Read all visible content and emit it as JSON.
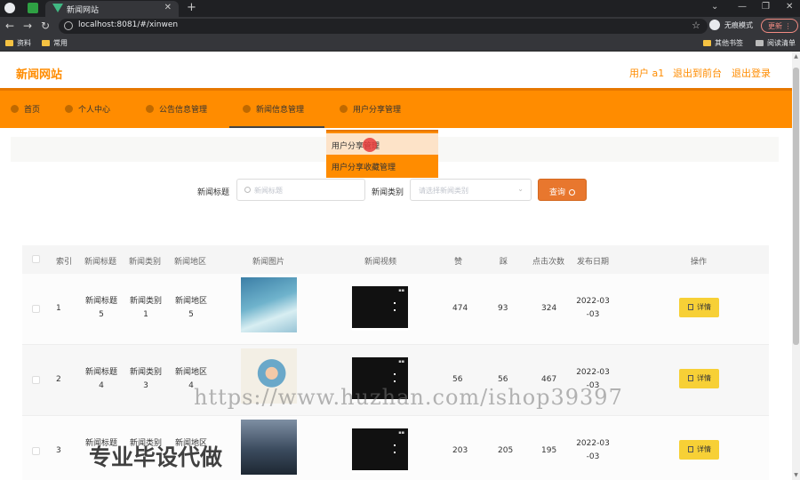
{
  "browser": {
    "tab_title": "新闻网站",
    "url": "localhost:8081/#/xinwen",
    "incognito_label": "无痕模式",
    "update_label": "更新",
    "bookmarks": [
      "资料",
      "常用"
    ],
    "bookmarks_right": [
      "其他书签",
      "阅读清单"
    ]
  },
  "header": {
    "site_title": "新闻网站",
    "user_label": "用户 a1",
    "back_label": "退出到前台",
    "logout_label": "退出登录"
  },
  "nav": {
    "items": [
      "首页",
      "个人中心",
      "公告信息管理",
      "新闻信息管理",
      "用户分享管理"
    ],
    "active_index": 3
  },
  "dropdown": {
    "items": [
      "用户分享管理",
      "用户分享收藏管理"
    ]
  },
  "search": {
    "title_label": "新闻标题",
    "title_placeholder": "新闻标题",
    "category_label": "新闻类别",
    "category_placeholder": "请选择新闻类别",
    "query_label": "查询"
  },
  "table": {
    "headers": [
      "索引",
      "新闻标题",
      "新闻类别",
      "新闻地区",
      "新闻图片",
      "新闻视频",
      "赞",
      "踩",
      "点击次数",
      "发布日期",
      "操作"
    ],
    "rows": [
      {
        "index": "1",
        "title": [
          "新闻标题",
          "5"
        ],
        "category": [
          "新闻类别",
          "1"
        ],
        "region": [
          "新闻地区",
          "5"
        ],
        "likes": "474",
        "dislikes": "93",
        "clicks": "324",
        "date": [
          "2022-03",
          "-03"
        ],
        "action": "详情"
      },
      {
        "index": "2",
        "title": [
          "新闻标题",
          "4"
        ],
        "category": [
          "新闻类别",
          "3"
        ],
        "region": [
          "新闻地区",
          "4"
        ],
        "likes": "56",
        "dislikes": "56",
        "clicks": "467",
        "date": [
          "2022-03",
          "-03"
        ],
        "action": "详情"
      },
      {
        "index": "3",
        "title": [
          "新闻标题",
          ""
        ],
        "category": [
          "新闻类别",
          ""
        ],
        "region": [
          "新闻地区",
          ""
        ],
        "likes": "203",
        "dislikes": "205",
        "clicks": "195",
        "date": [
          "2022-03",
          "-03"
        ],
        "action": "详情"
      }
    ]
  },
  "watermarks": {
    "url_text": "https://www.huzhan.com/ishop39397",
    "slogan": "专业毕设代做"
  },
  "colors": {
    "accent": "#ff8c00",
    "button": "#e8772e",
    "detail": "#f7d036"
  }
}
